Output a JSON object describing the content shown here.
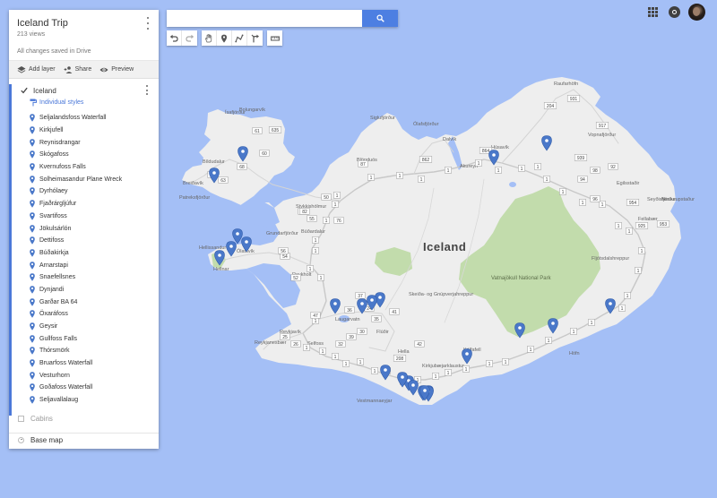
{
  "map": {
    "country_label": "Iceland",
    "towns": [
      {
        "name": "Raufarhöfn"
      },
      {
        "name": "Ólafsfjörður"
      },
      {
        "name": "Siglufjörður"
      },
      {
        "name": "Húsavík"
      },
      {
        "name": "Dalvík"
      },
      {
        "name": "Akureyri"
      },
      {
        "name": "Vopnafjörður"
      },
      {
        "name": "Egilsstaðir"
      },
      {
        "name": "Fellabær"
      },
      {
        "name": "Seyðisfjörður"
      },
      {
        "name": "Neskaupstaður"
      },
      {
        "name": "Ísafjörður"
      },
      {
        "name": "Bolungarvík"
      },
      {
        "name": "Bíldudalur"
      },
      {
        "name": "Patreksfjörður"
      },
      {
        "name": "Breiðavík"
      },
      {
        "name": "Búðardalur"
      },
      {
        "name": "Stykkishólmur"
      },
      {
        "name": "Hellissandur"
      },
      {
        "name": "Ólafsvík"
      },
      {
        "name": "Grundarfjörður"
      },
      {
        "name": "Hellnar"
      },
      {
        "name": "Reykholt"
      },
      {
        "name": "Skeiða- og Gnúpverjahreppur"
      },
      {
        "name": "Laugarvatn"
      },
      {
        "name": "Reykjavík"
      },
      {
        "name": "Reykjanesbær"
      },
      {
        "name": "Selfoss"
      },
      {
        "name": "Flúðir"
      },
      {
        "name": "Hella"
      },
      {
        "name": "Vestmannaeyjar"
      },
      {
        "name": "Kirkjubæjarklaustur"
      },
      {
        "name": "Kálfafell"
      },
      {
        "name": "Höfn"
      },
      {
        "name": "Fljótsdalshreppur"
      },
      {
        "name": "Blönduós"
      }
    ],
    "park_label": "Vatnajökull National Park",
    "route_labels": [
      "61",
      "60",
      "62",
      "63",
      "635",
      "68",
      "85",
      "82",
      "76",
      "87",
      "862",
      "864",
      "1",
      "1",
      "1",
      "1",
      "1",
      "1",
      "1",
      "1",
      "1",
      "1",
      "1",
      "1",
      "1",
      "1",
      "1",
      "1",
      "1",
      "1",
      "1",
      "1",
      "1",
      "1",
      "1",
      "1",
      "1",
      "1",
      "1",
      "1",
      "1",
      "1",
      "1",
      "1",
      "1",
      "1",
      "1",
      "1",
      "1",
      "1",
      "1",
      "1",
      "1",
      "1",
      "1",
      "1",
      "54",
      "56",
      "55",
      "50",
      "52",
      "47",
      "36",
      "37",
      "35",
      "30",
      "32",
      "39",
      "26",
      "25",
      "24",
      "41",
      "42",
      "208",
      "204",
      "931",
      "917",
      "94",
      "925",
      "953",
      "954",
      "96",
      "92",
      "98",
      "939",
      "85",
      "867"
    ]
  },
  "panel": {
    "title": "Iceland Trip",
    "views": "213 views",
    "saved": "All changes saved in Drive",
    "actions": {
      "add_layer": "Add layer",
      "share": "Share",
      "preview": "Preview"
    },
    "layer": {
      "name": "Iceland",
      "styles": "Individual styles",
      "places": [
        "Seljalandsfoss Waterfall",
        "Kirkjufell",
        "Reynisdrangar",
        "Skógafoss",
        "Kvernufoss Falls",
        "Solheimasandur Plane Wreck",
        "Dyrhólaey",
        "Fjaðrárgljúfur",
        "Svartifoss",
        "Jökulsárlón",
        "Dettifoss",
        "Búðakirkja",
        "Arnarstapi",
        "Snaefellsnes",
        "Dynjandi",
        "Garðar BA 64",
        "Öxaráfoss",
        "Geysir",
        "Gullfoss Falls",
        "Thórsmörk",
        "Bruarfoss Waterfall",
        "Vesturhorn",
        "Goðafoss Waterfall",
        "Seljavallalaug"
      ]
    },
    "cabins": "Cabins",
    "base_map": "Base map"
  },
  "search": {
    "value": "",
    "placeholder": ""
  },
  "colors": {
    "water": "#a4bff6",
    "land": "#eeeeee",
    "park": "#c2dcac",
    "road_main": "#c9c9c9",
    "accent": "#4b78d9",
    "marker": "#4a78c9"
  },
  "icons": {
    "toolbar": [
      "undo-icon",
      "redo-icon",
      "hand-icon",
      "marker-icon",
      "line-icon",
      "directions-icon",
      "ruler-icon"
    ],
    "top_right": [
      "apps-grid-icon",
      "notifications-icon",
      "avatar"
    ]
  }
}
